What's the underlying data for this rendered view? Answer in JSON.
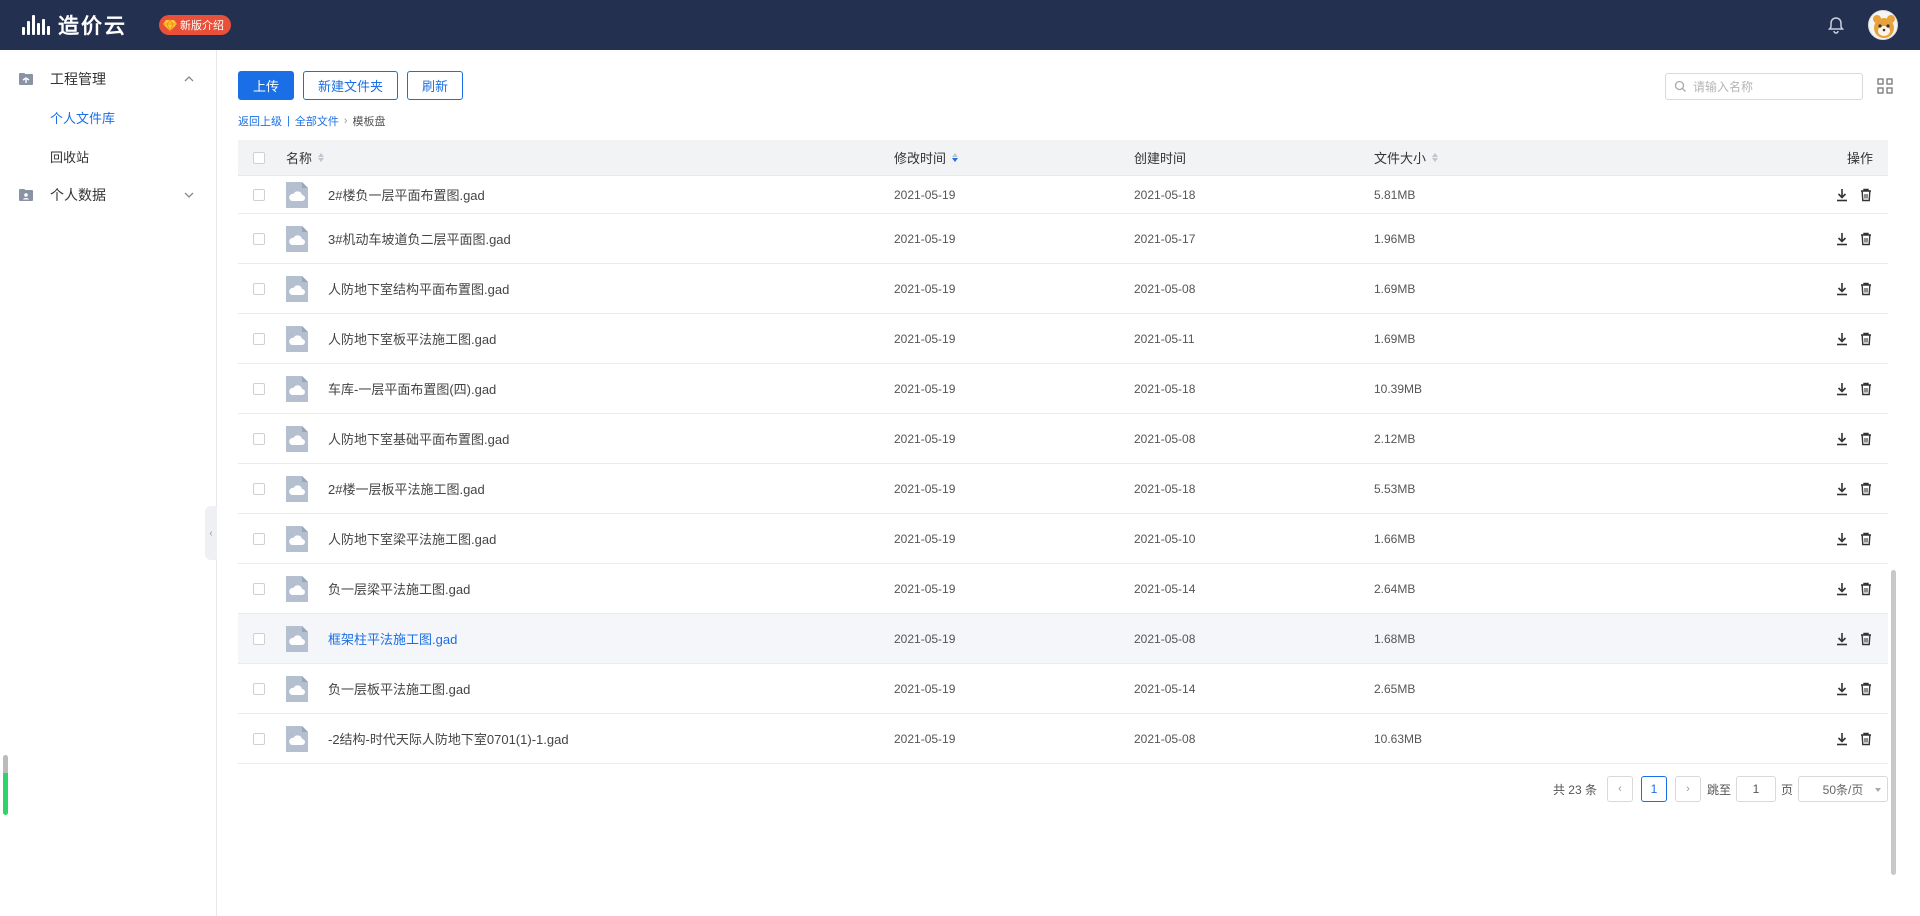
{
  "app": {
    "logo_text": "造价云",
    "new_version_label": "新版介绍"
  },
  "sidebar": {
    "groups": [
      {
        "label": "工程管理",
        "expanded": true,
        "items": [
          {
            "label": "个人文件库",
            "active": true
          },
          {
            "label": "回收站",
            "active": false
          }
        ]
      },
      {
        "label": "个人数据",
        "expanded": false,
        "items": []
      }
    ]
  },
  "toolbar": {
    "upload_label": "上传",
    "new_folder_label": "新建文件夹",
    "refresh_label": "刷新"
  },
  "search": {
    "placeholder": "请输入名称"
  },
  "breadcrumb": {
    "back": "返回上级",
    "divider": "|",
    "all_files": "全部文件",
    "arrow": "›",
    "current": "模板盘"
  },
  "table": {
    "headers": {
      "name": "名称",
      "modified": "修改时间",
      "created": "创建时间",
      "size": "文件大小",
      "ops": "操作"
    },
    "sort_active": "modified",
    "rows": [
      {
        "name": "2#楼负一层平面布置图.gad",
        "modified": "2021-05-19",
        "created": "2021-05-18",
        "size": "5.81MB"
      },
      {
        "name": "3#机动车坡道负二层平面图.gad",
        "modified": "2021-05-19",
        "created": "2021-05-17",
        "size": "1.96MB"
      },
      {
        "name": "人防地下室结构平面布置图.gad",
        "modified": "2021-05-19",
        "created": "2021-05-08",
        "size": "1.69MB"
      },
      {
        "name": "人防地下室板平法施工图.gad",
        "modified": "2021-05-19",
        "created": "2021-05-11",
        "size": "1.69MB"
      },
      {
        "name": "车库-一层平面布置图(四).gad",
        "modified": "2021-05-19",
        "created": "2021-05-18",
        "size": "10.39MB"
      },
      {
        "name": "人防地下室基础平面布置图.gad",
        "modified": "2021-05-19",
        "created": "2021-05-08",
        "size": "2.12MB"
      },
      {
        "name": "2#楼一层板平法施工图.gad",
        "modified": "2021-05-19",
        "created": "2021-05-18",
        "size": "5.53MB"
      },
      {
        "name": "人防地下室梁平法施工图.gad",
        "modified": "2021-05-19",
        "created": "2021-05-10",
        "size": "1.66MB"
      },
      {
        "name": "负一层梁平法施工图.gad",
        "modified": "2021-05-19",
        "created": "2021-05-14",
        "size": "2.64MB"
      },
      {
        "name": "框架柱平法施工图.gad",
        "modified": "2021-05-19",
        "created": "2021-05-08",
        "size": "1.68MB",
        "hover": true
      },
      {
        "name": "负一层板平法施工图.gad",
        "modified": "2021-05-19",
        "created": "2021-05-14",
        "size": "2.65MB"
      },
      {
        "name": "-2结构-时代天际人防地下室0701(1)-1.gad",
        "modified": "2021-05-19",
        "created": "2021-05-08",
        "size": "10.63MB"
      }
    ]
  },
  "pagination": {
    "total_label": "共 23 条",
    "prev": "‹",
    "current_page": "1",
    "next": "›",
    "jump_label": "跳至",
    "jump_value": "1",
    "page_unit": "页",
    "page_size": "50条/页"
  },
  "colors": {
    "topbar": "#23304f",
    "accent": "#1a6fe6",
    "badge": "#e8503a",
    "file_icon": "#b4c0d0"
  },
  "icons": {
    "bell": "bell-icon",
    "grid": "grid-view-icon",
    "download": "download-icon",
    "delete": "trash-icon",
    "search": "search-icon"
  }
}
